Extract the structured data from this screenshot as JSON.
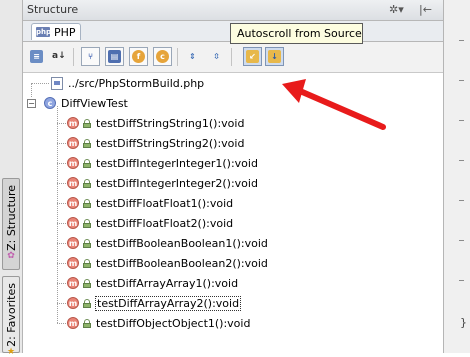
{
  "tool_window": {
    "title": "Structure",
    "gear_icon": "gear-icon",
    "hide_icon": "hide-panel-icon"
  },
  "file_tab": {
    "label": "PHP",
    "icon_text": "php"
  },
  "toolbar": {
    "buttons": [
      {
        "name": "sort-visibility-button",
        "glyph": "≡"
      },
      {
        "name": "sort-alpha-button",
        "glyph": "a↓"
      },
      {
        "name": "show-inherited-button",
        "glyph": "⑂"
      },
      {
        "name": "show-fields-button",
        "glyph": "f"
      },
      {
        "name": "show-constants-button",
        "glyph": "c"
      },
      {
        "name": "show-includes-button",
        "glyph": "●"
      },
      {
        "name": "expand-all-button",
        "glyph": "⇕"
      },
      {
        "name": "collapse-all-button",
        "glyph": "⇳"
      },
      {
        "name": "autoscroll-to-source-button",
        "glyph": "↙"
      },
      {
        "name": "autoscroll-from-source-button",
        "glyph": "↓"
      }
    ],
    "tooltip": "Autoscroll from Source"
  },
  "tree": {
    "file_node": "../src/PhpStormBuild.php",
    "class_node": "DiffViewTest",
    "methods": [
      "testDiffStringString1():void",
      "testDiffStringString2():void",
      "testDiffIntegerInteger1():void",
      "testDiffIntegerInteger2():void",
      "testDiffFloatFloat1():void",
      "testDiffFloatFloat2():void",
      "testDiffBooleanBoolean1():void",
      "testDiffBooleanBoolean2():void",
      "testDiffArrayArray1():void",
      "testDiffArrayArray2():void",
      "testDiffObjectObject1():void"
    ],
    "focused_index": 9,
    "method_badge": "m",
    "class_badge": "c"
  },
  "side_tabs": {
    "structure": "Z: Structure",
    "favorites": "2: Favorites"
  },
  "gutter": {
    "brace": "}"
  },
  "colors": {
    "accent_arrow": "#e81b1b",
    "tooltip_bg": "#fdfde0"
  }
}
